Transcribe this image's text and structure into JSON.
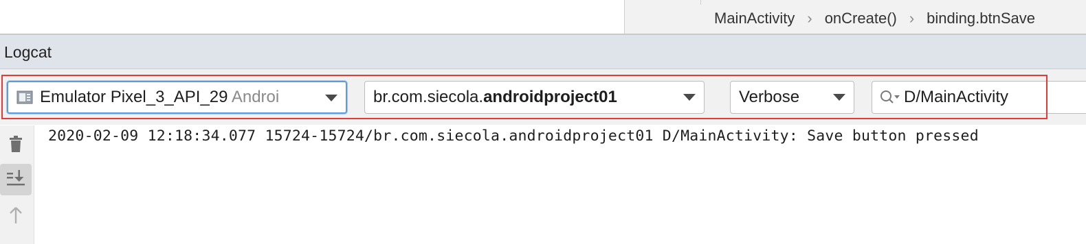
{
  "breadcrumb": {
    "items": [
      "MainActivity",
      "onCreate()",
      "binding.btnSave"
    ],
    "separator": "›"
  },
  "logcat": {
    "title": "Logcat"
  },
  "toolbar": {
    "device": {
      "name": "Emulator Pixel_3_API_29",
      "suffix": "Androi",
      "icon": "emulator-icon"
    },
    "package": {
      "prefix": "br.com.siecola.",
      "bold": "androidproject01"
    },
    "log_level": {
      "selected": "Verbose"
    },
    "search": {
      "value": "D/MainActivity",
      "icon": "search-icon"
    },
    "highlight_color": "#e53935"
  },
  "side_tools": [
    {
      "name": "trash-icon"
    },
    {
      "name": "scroll-to-end-icon",
      "active": true
    },
    {
      "name": "up-arrow-icon"
    }
  ],
  "log": {
    "lines": [
      "2020-02-09 12:18:34.077 15724-15724/br.com.siecola.androidproject01 D/MainActivity: Save button pressed"
    ]
  }
}
